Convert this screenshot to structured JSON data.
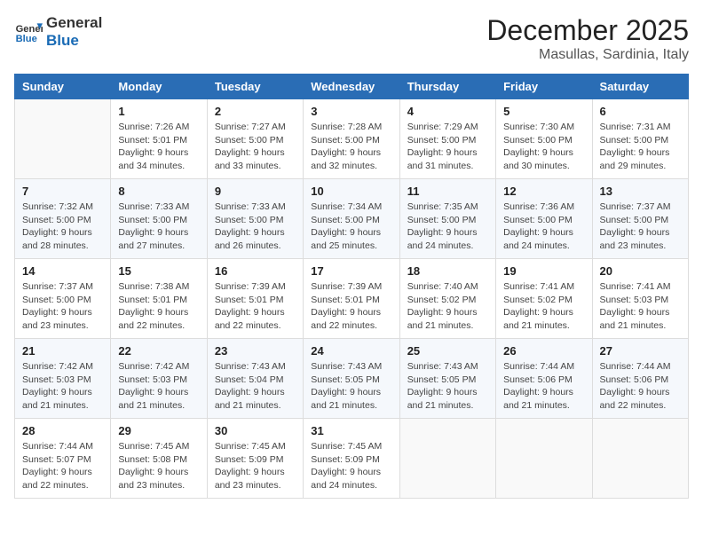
{
  "header": {
    "logo_general": "General",
    "logo_blue": "Blue",
    "month": "December 2025",
    "location": "Masullas, Sardinia, Italy"
  },
  "days_of_week": [
    "Sunday",
    "Monday",
    "Tuesday",
    "Wednesday",
    "Thursday",
    "Friday",
    "Saturday"
  ],
  "weeks": [
    [
      {
        "day": "",
        "info": ""
      },
      {
        "day": "1",
        "info": "Sunrise: 7:26 AM\nSunset: 5:01 PM\nDaylight: 9 hours\nand 34 minutes."
      },
      {
        "day": "2",
        "info": "Sunrise: 7:27 AM\nSunset: 5:00 PM\nDaylight: 9 hours\nand 33 minutes."
      },
      {
        "day": "3",
        "info": "Sunrise: 7:28 AM\nSunset: 5:00 PM\nDaylight: 9 hours\nand 32 minutes."
      },
      {
        "day": "4",
        "info": "Sunrise: 7:29 AM\nSunset: 5:00 PM\nDaylight: 9 hours\nand 31 minutes."
      },
      {
        "day": "5",
        "info": "Sunrise: 7:30 AM\nSunset: 5:00 PM\nDaylight: 9 hours\nand 30 minutes."
      },
      {
        "day": "6",
        "info": "Sunrise: 7:31 AM\nSunset: 5:00 PM\nDaylight: 9 hours\nand 29 minutes."
      }
    ],
    [
      {
        "day": "7",
        "info": "Sunrise: 7:32 AM\nSunset: 5:00 PM\nDaylight: 9 hours\nand 28 minutes."
      },
      {
        "day": "8",
        "info": "Sunrise: 7:33 AM\nSunset: 5:00 PM\nDaylight: 9 hours\nand 27 minutes."
      },
      {
        "day": "9",
        "info": "Sunrise: 7:33 AM\nSunset: 5:00 PM\nDaylight: 9 hours\nand 26 minutes."
      },
      {
        "day": "10",
        "info": "Sunrise: 7:34 AM\nSunset: 5:00 PM\nDaylight: 9 hours\nand 25 minutes."
      },
      {
        "day": "11",
        "info": "Sunrise: 7:35 AM\nSunset: 5:00 PM\nDaylight: 9 hours\nand 24 minutes."
      },
      {
        "day": "12",
        "info": "Sunrise: 7:36 AM\nSunset: 5:00 PM\nDaylight: 9 hours\nand 24 minutes."
      },
      {
        "day": "13",
        "info": "Sunrise: 7:37 AM\nSunset: 5:00 PM\nDaylight: 9 hours\nand 23 minutes."
      }
    ],
    [
      {
        "day": "14",
        "info": "Sunrise: 7:37 AM\nSunset: 5:00 PM\nDaylight: 9 hours\nand 23 minutes."
      },
      {
        "day": "15",
        "info": "Sunrise: 7:38 AM\nSunset: 5:01 PM\nDaylight: 9 hours\nand 22 minutes."
      },
      {
        "day": "16",
        "info": "Sunrise: 7:39 AM\nSunset: 5:01 PM\nDaylight: 9 hours\nand 22 minutes."
      },
      {
        "day": "17",
        "info": "Sunrise: 7:39 AM\nSunset: 5:01 PM\nDaylight: 9 hours\nand 22 minutes."
      },
      {
        "day": "18",
        "info": "Sunrise: 7:40 AM\nSunset: 5:02 PM\nDaylight: 9 hours\nand 21 minutes."
      },
      {
        "day": "19",
        "info": "Sunrise: 7:41 AM\nSunset: 5:02 PM\nDaylight: 9 hours\nand 21 minutes."
      },
      {
        "day": "20",
        "info": "Sunrise: 7:41 AM\nSunset: 5:03 PM\nDaylight: 9 hours\nand 21 minutes."
      }
    ],
    [
      {
        "day": "21",
        "info": "Sunrise: 7:42 AM\nSunset: 5:03 PM\nDaylight: 9 hours\nand 21 minutes."
      },
      {
        "day": "22",
        "info": "Sunrise: 7:42 AM\nSunset: 5:03 PM\nDaylight: 9 hours\nand 21 minutes."
      },
      {
        "day": "23",
        "info": "Sunrise: 7:43 AM\nSunset: 5:04 PM\nDaylight: 9 hours\nand 21 minutes."
      },
      {
        "day": "24",
        "info": "Sunrise: 7:43 AM\nSunset: 5:05 PM\nDaylight: 9 hours\nand 21 minutes."
      },
      {
        "day": "25",
        "info": "Sunrise: 7:43 AM\nSunset: 5:05 PM\nDaylight: 9 hours\nand 21 minutes."
      },
      {
        "day": "26",
        "info": "Sunrise: 7:44 AM\nSunset: 5:06 PM\nDaylight: 9 hours\nand 21 minutes."
      },
      {
        "day": "27",
        "info": "Sunrise: 7:44 AM\nSunset: 5:06 PM\nDaylight: 9 hours\nand 22 minutes."
      }
    ],
    [
      {
        "day": "28",
        "info": "Sunrise: 7:44 AM\nSunset: 5:07 PM\nDaylight: 9 hours\nand 22 minutes."
      },
      {
        "day": "29",
        "info": "Sunrise: 7:45 AM\nSunset: 5:08 PM\nDaylight: 9 hours\nand 23 minutes."
      },
      {
        "day": "30",
        "info": "Sunrise: 7:45 AM\nSunset: 5:09 PM\nDaylight: 9 hours\nand 23 minutes."
      },
      {
        "day": "31",
        "info": "Sunrise: 7:45 AM\nSunset: 5:09 PM\nDaylight: 9 hours\nand 24 minutes."
      },
      {
        "day": "",
        "info": ""
      },
      {
        "day": "",
        "info": ""
      },
      {
        "day": "",
        "info": ""
      }
    ]
  ]
}
